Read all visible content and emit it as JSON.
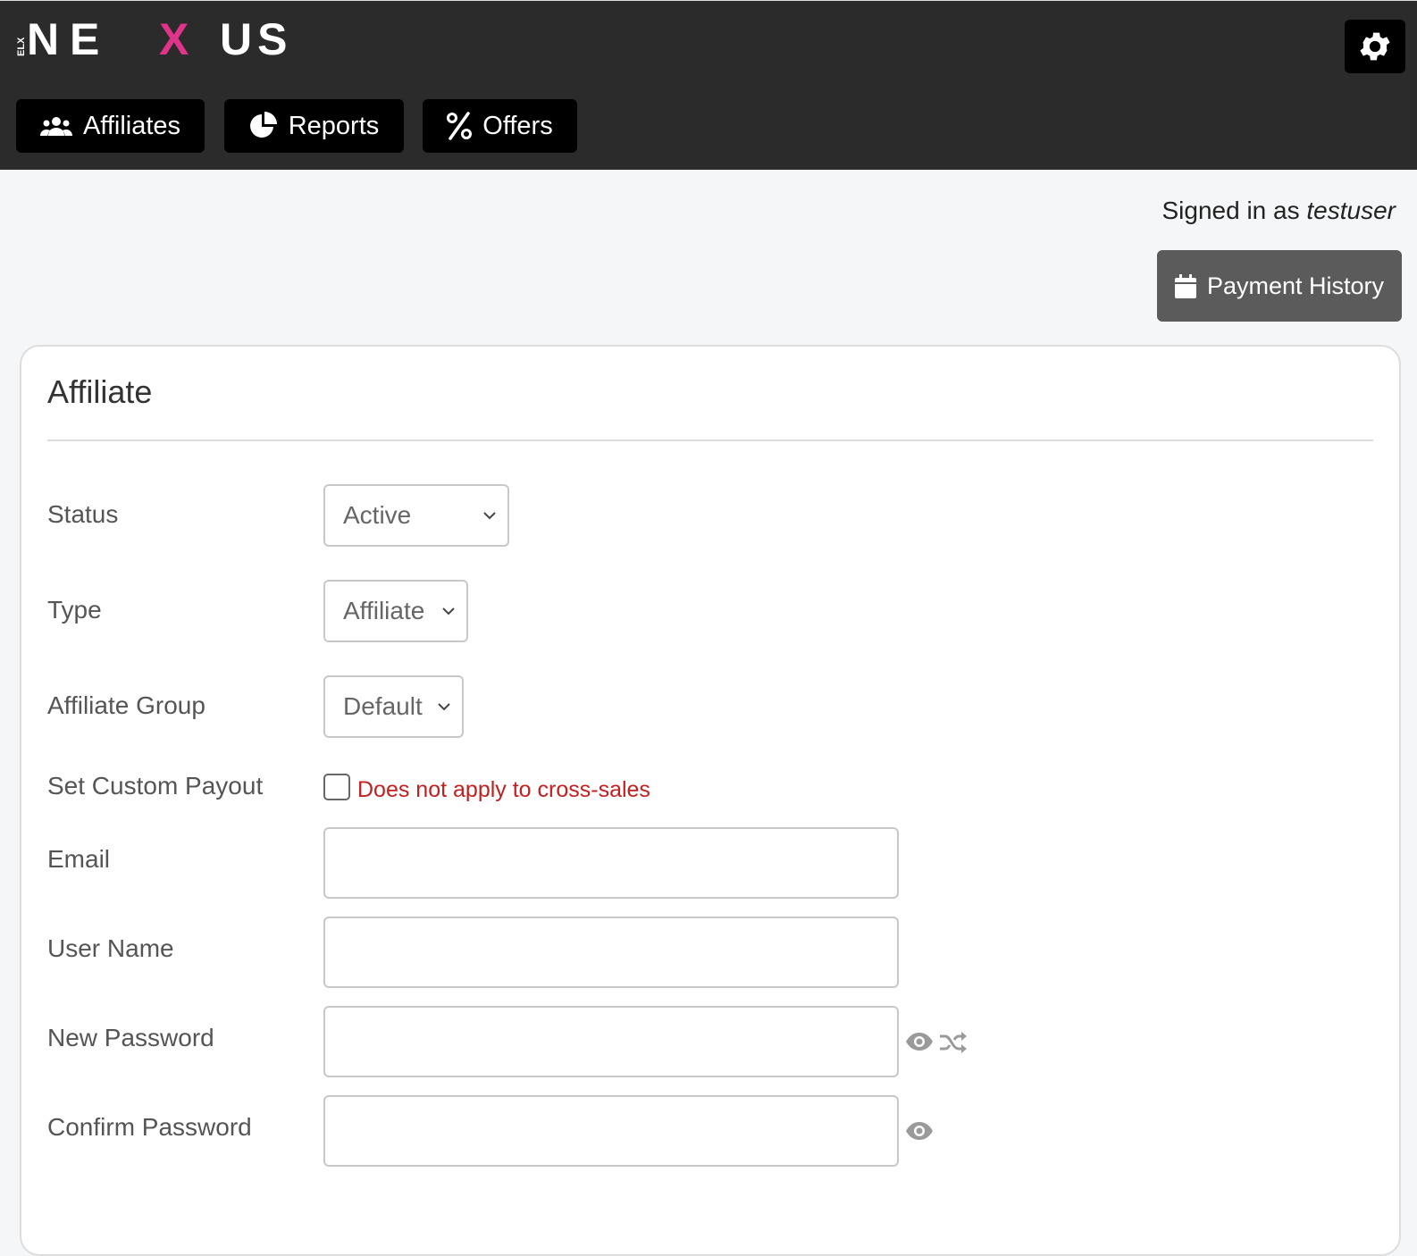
{
  "brand": {
    "logo_text": "NEXUS",
    "logo_prefix": "ELX",
    "accent_color": "#e0338a"
  },
  "nav": {
    "items": [
      {
        "label": "Affiliates",
        "icon": "users-icon"
      },
      {
        "label": "Reports",
        "icon": "pie-chart-icon"
      },
      {
        "label": "Offers",
        "icon": "percent-icon"
      }
    ],
    "settings_icon": "gear-icon"
  },
  "user": {
    "signed_in_prefix": "Signed in as",
    "username": "testuser"
  },
  "actions": {
    "payment_history": "Payment History",
    "payment_history_icon": "calendar-icon"
  },
  "form": {
    "title": "Affiliate",
    "status": {
      "label": "Status",
      "value": "Active"
    },
    "type": {
      "label": "Type",
      "value": "Affiliate"
    },
    "group": {
      "label": "Affiliate Group",
      "value": "Default"
    },
    "custom_payout": {
      "label": "Set Custom Payout",
      "checked": false,
      "note": "Does not apply to cross-sales",
      "note_color": "#c41f1f"
    },
    "email": {
      "label": "Email",
      "value": ""
    },
    "username": {
      "label": "User Name",
      "value": ""
    },
    "new_password": {
      "label": "New Password",
      "value": "",
      "icons": [
        "eye-icon",
        "shuffle-icon"
      ]
    },
    "confirm_password": {
      "label": "Confirm Password",
      "value": "",
      "icons": [
        "eye-icon"
      ]
    }
  }
}
